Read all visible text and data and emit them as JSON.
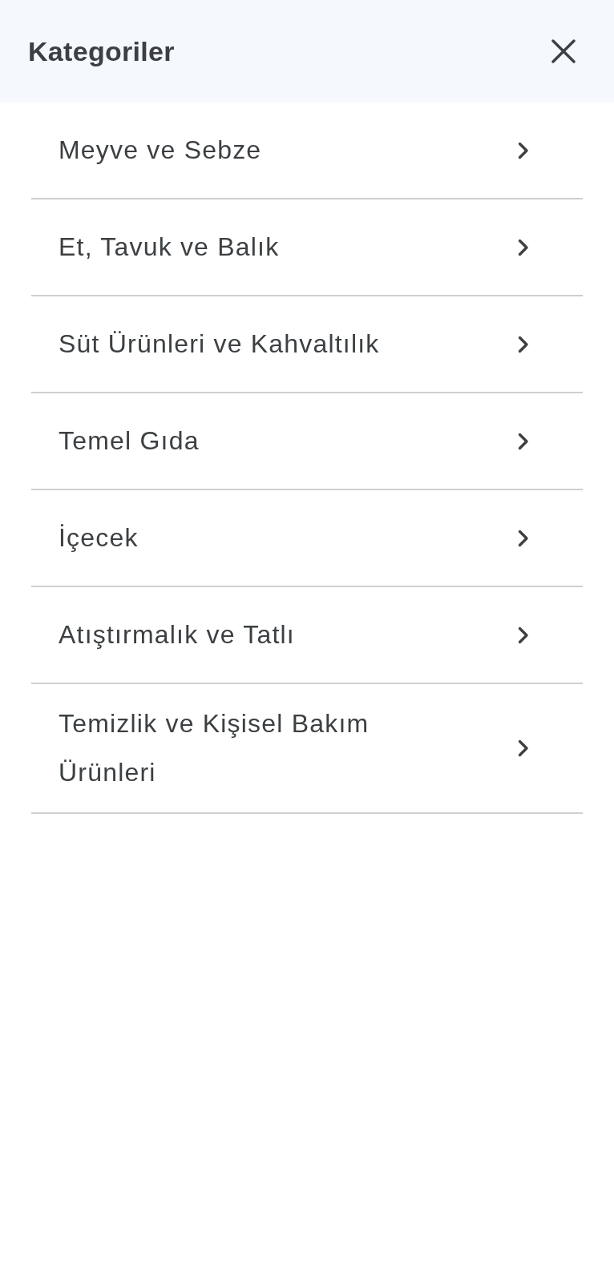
{
  "header": {
    "title": "Kategoriler"
  },
  "categories": [
    {
      "label": "Meyve ve Sebze"
    },
    {
      "label": "Et, Tavuk ve Balık"
    },
    {
      "label": "Süt Ürünleri ve Kahvaltılık"
    },
    {
      "label": "Temel Gıda"
    },
    {
      "label": "İçecek"
    },
    {
      "label": "Atıştırmalık ve Tatlı"
    },
    {
      "label": "Temizlik ve Kişisel Bakım Ürünleri"
    }
  ]
}
